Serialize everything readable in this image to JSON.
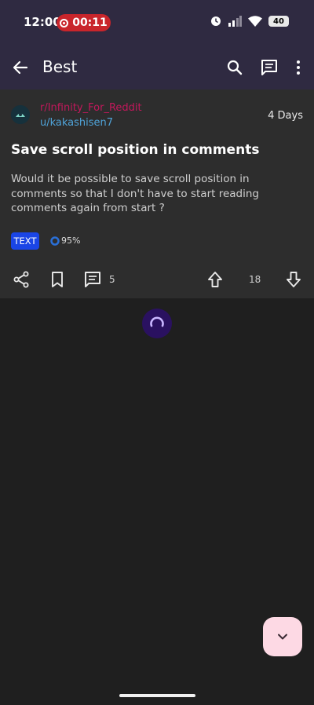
{
  "status_bar": {
    "time": "12:00",
    "recording_time": "00:11",
    "battery_level": "40",
    "icons": [
      "alarm-icon",
      "signal-icon",
      "wifi-icon",
      "battery-icon"
    ]
  },
  "app_bar": {
    "title": "Best",
    "icons": [
      "back-arrow-icon",
      "search-icon",
      "comment-icon",
      "more-vert-icon"
    ]
  },
  "post": {
    "subreddit": "r/Infinity_For_Reddit",
    "author": "u/kakashisen7",
    "time": "4 Days",
    "title": "Save scroll position in comments",
    "body": "Would it be possible to save scroll position in comments so that I don't have to start reading comments again from start ?",
    "type_badge": "TEXT",
    "upvote_ratio": "95%",
    "comment_count": "5",
    "score": "18"
  },
  "colors": {
    "app_bar_bg": "#2f2a41",
    "card_bg": "#2d2d2d",
    "page_bg": "#1f1f1f",
    "subreddit": "#c2185b",
    "username": "#4fa3d8",
    "badge": "#1a45e6",
    "fab_bg": "#fdd9e4",
    "recording_pill": "#c9252b"
  }
}
